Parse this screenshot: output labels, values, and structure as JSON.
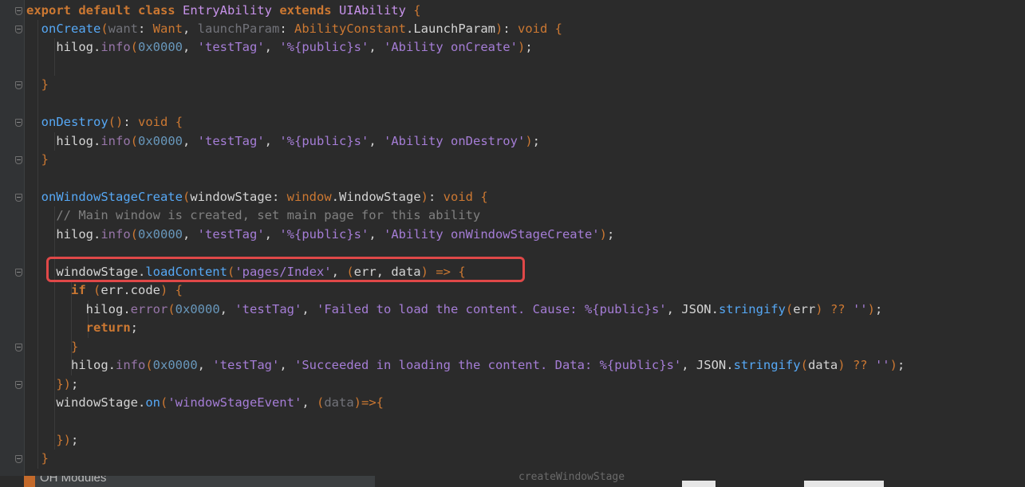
{
  "editor": {
    "lines": [
      [
        [
          "kw",
          "export "
        ],
        [
          "kw",
          "default "
        ],
        [
          "kw",
          "class "
        ],
        [
          "cls",
          "EntryAbility "
        ],
        [
          "kw",
          "extends "
        ],
        [
          "cls",
          "UIAbility "
        ],
        [
          "pun",
          "{"
        ]
      ],
      [
        [
          "txt",
          "  "
        ],
        [
          "fn",
          "onCreate"
        ],
        [
          "pun",
          "("
        ],
        [
          "param",
          "want"
        ],
        [
          "txt",
          ": "
        ],
        [
          "typ",
          "Want"
        ],
        [
          "txt",
          ", "
        ],
        [
          "param",
          "launchParam"
        ],
        [
          "txt",
          ": "
        ],
        [
          "typ",
          "AbilityConstant"
        ],
        [
          "txt",
          "."
        ],
        [
          "txt",
          "LaunchParam"
        ],
        [
          "pun",
          ")"
        ],
        [
          "txt",
          ": "
        ],
        [
          "typ",
          "void "
        ],
        [
          "pun",
          "{"
        ]
      ],
      [
        [
          "txt",
          "    hilog."
        ],
        [
          "prop",
          "info"
        ],
        [
          "pun",
          "("
        ],
        [
          "num",
          "0x0000"
        ],
        [
          "txt",
          ", "
        ],
        [
          "str",
          "'testTag'"
        ],
        [
          "txt",
          ", "
        ],
        [
          "str",
          "'%{public}s'"
        ],
        [
          "txt",
          ", "
        ],
        [
          "str",
          "'Ability onCreate'"
        ],
        [
          "pun",
          ")"
        ],
        [
          "txt",
          ";"
        ]
      ],
      [
        [
          "txt",
          ""
        ]
      ],
      [
        [
          "txt",
          "  "
        ],
        [
          "pun",
          "}"
        ]
      ],
      [
        [
          "txt",
          ""
        ]
      ],
      [
        [
          "txt",
          "  "
        ],
        [
          "fn",
          "onDestroy"
        ],
        [
          "pun",
          "()"
        ],
        [
          "txt",
          ": "
        ],
        [
          "typ",
          "void "
        ],
        [
          "pun",
          "{"
        ]
      ],
      [
        [
          "txt",
          "    hilog."
        ],
        [
          "prop",
          "info"
        ],
        [
          "pun",
          "("
        ],
        [
          "num",
          "0x0000"
        ],
        [
          "txt",
          ", "
        ],
        [
          "str",
          "'testTag'"
        ],
        [
          "txt",
          ", "
        ],
        [
          "str",
          "'%{public}s'"
        ],
        [
          "txt",
          ", "
        ],
        [
          "str",
          "'Ability onDestroy'"
        ],
        [
          "pun",
          ")"
        ],
        [
          "txt",
          ";"
        ]
      ],
      [
        [
          "txt",
          "  "
        ],
        [
          "pun",
          "}"
        ]
      ],
      [
        [
          "txt",
          ""
        ]
      ],
      [
        [
          "txt",
          "  "
        ],
        [
          "fn",
          "onWindowStageCreate"
        ],
        [
          "pun",
          "("
        ],
        [
          "txt",
          "windowStage: "
        ],
        [
          "typ",
          "window"
        ],
        [
          "txt",
          "."
        ],
        [
          "txt",
          "WindowStage"
        ],
        [
          "pun",
          ")"
        ],
        [
          "txt",
          ": "
        ],
        [
          "typ",
          "void "
        ],
        [
          "pun",
          "{"
        ]
      ],
      [
        [
          "cmt",
          "    // Main window is created, set main page for this ability"
        ]
      ],
      [
        [
          "txt",
          "    hilog."
        ],
        [
          "prop",
          "info"
        ],
        [
          "pun",
          "("
        ],
        [
          "num",
          "0x0000"
        ],
        [
          "txt",
          ", "
        ],
        [
          "str",
          "'testTag'"
        ],
        [
          "txt",
          ", "
        ],
        [
          "str",
          "'%{public}s'"
        ],
        [
          "txt",
          ", "
        ],
        [
          "str",
          "'Ability onWindowStageCreate'"
        ],
        [
          "pun",
          ")"
        ],
        [
          "txt",
          ";"
        ]
      ],
      [
        [
          "txt",
          ""
        ]
      ],
      [
        [
          "txt",
          "    windowStage."
        ],
        [
          "fn",
          "loadContent"
        ],
        [
          "pun",
          "("
        ],
        [
          "str",
          "'pages/Index'"
        ],
        [
          "txt",
          ", "
        ],
        [
          "pun",
          "("
        ],
        [
          "txt",
          "err, data"
        ],
        [
          "pun",
          ") "
        ],
        [
          "kwn",
          "=> "
        ],
        [
          "pun",
          "{"
        ]
      ],
      [
        [
          "txt",
          "      "
        ],
        [
          "kw",
          "if "
        ],
        [
          "pun",
          "("
        ],
        [
          "txt",
          "err.code"
        ],
        [
          "pun",
          ") "
        ],
        [
          "pun",
          "{"
        ]
      ],
      [
        [
          "txt",
          "        hilog."
        ],
        [
          "prop",
          "error"
        ],
        [
          "pun",
          "("
        ],
        [
          "num",
          "0x0000"
        ],
        [
          "txt",
          ", "
        ],
        [
          "str",
          "'testTag'"
        ],
        [
          "txt",
          ", "
        ],
        [
          "str",
          "'Failed to load the content. Cause: %{public}s'"
        ],
        [
          "txt",
          ", JSON."
        ],
        [
          "fn",
          "stringify"
        ],
        [
          "pun",
          "("
        ],
        [
          "txt",
          "err"
        ],
        [
          "pun",
          ") "
        ],
        [
          "kwn",
          "?? "
        ],
        [
          "str",
          "''"
        ],
        [
          "pun",
          ")"
        ],
        [
          "txt",
          ";"
        ]
      ],
      [
        [
          "txt",
          "        "
        ],
        [
          "kw",
          "return"
        ],
        [
          "txt",
          ";"
        ]
      ],
      [
        [
          "txt",
          "      "
        ],
        [
          "pun",
          "}"
        ]
      ],
      [
        [
          "txt",
          "      hilog."
        ],
        [
          "prop",
          "info"
        ],
        [
          "pun",
          "("
        ],
        [
          "num",
          "0x0000"
        ],
        [
          "txt",
          ", "
        ],
        [
          "str",
          "'testTag'"
        ],
        [
          "txt",
          ", "
        ],
        [
          "str",
          "'Succeeded in loading the content. Data: %{public}s'"
        ],
        [
          "txt",
          ", JSON."
        ],
        [
          "fn",
          "stringify"
        ],
        [
          "pun",
          "("
        ],
        [
          "txt",
          "data"
        ],
        [
          "pun",
          ") "
        ],
        [
          "kwn",
          "?? "
        ],
        [
          "str",
          "''"
        ],
        [
          "pun",
          ")"
        ],
        [
          "txt",
          ";"
        ]
      ],
      [
        [
          "txt",
          "    "
        ],
        [
          "pun",
          "})"
        ],
        [
          "txt",
          ";"
        ]
      ],
      [
        [
          "txt",
          "    windowStage."
        ],
        [
          "fn",
          "on"
        ],
        [
          "pun",
          "("
        ],
        [
          "str",
          "'windowStageEvent'"
        ],
        [
          "txt",
          ", "
        ],
        [
          "pun",
          "("
        ],
        [
          "param",
          "data"
        ],
        [
          "pun",
          ")"
        ],
        [
          "kwn",
          "=>"
        ],
        [
          "pun",
          "{"
        ]
      ],
      [
        [
          "txt",
          ""
        ]
      ],
      [
        [
          "txt",
          "    "
        ],
        [
          "pun",
          "})"
        ],
        [
          "txt",
          ";"
        ]
      ],
      [
        [
          "txt",
          "  "
        ],
        [
          "pun",
          "}"
        ]
      ]
    ]
  },
  "bottom": {
    "tab_label": "OH Modules",
    "status_text": "createWindowStage"
  },
  "colors": {
    "background": "#2b2b2b",
    "highlight_border": "#e04848"
  }
}
